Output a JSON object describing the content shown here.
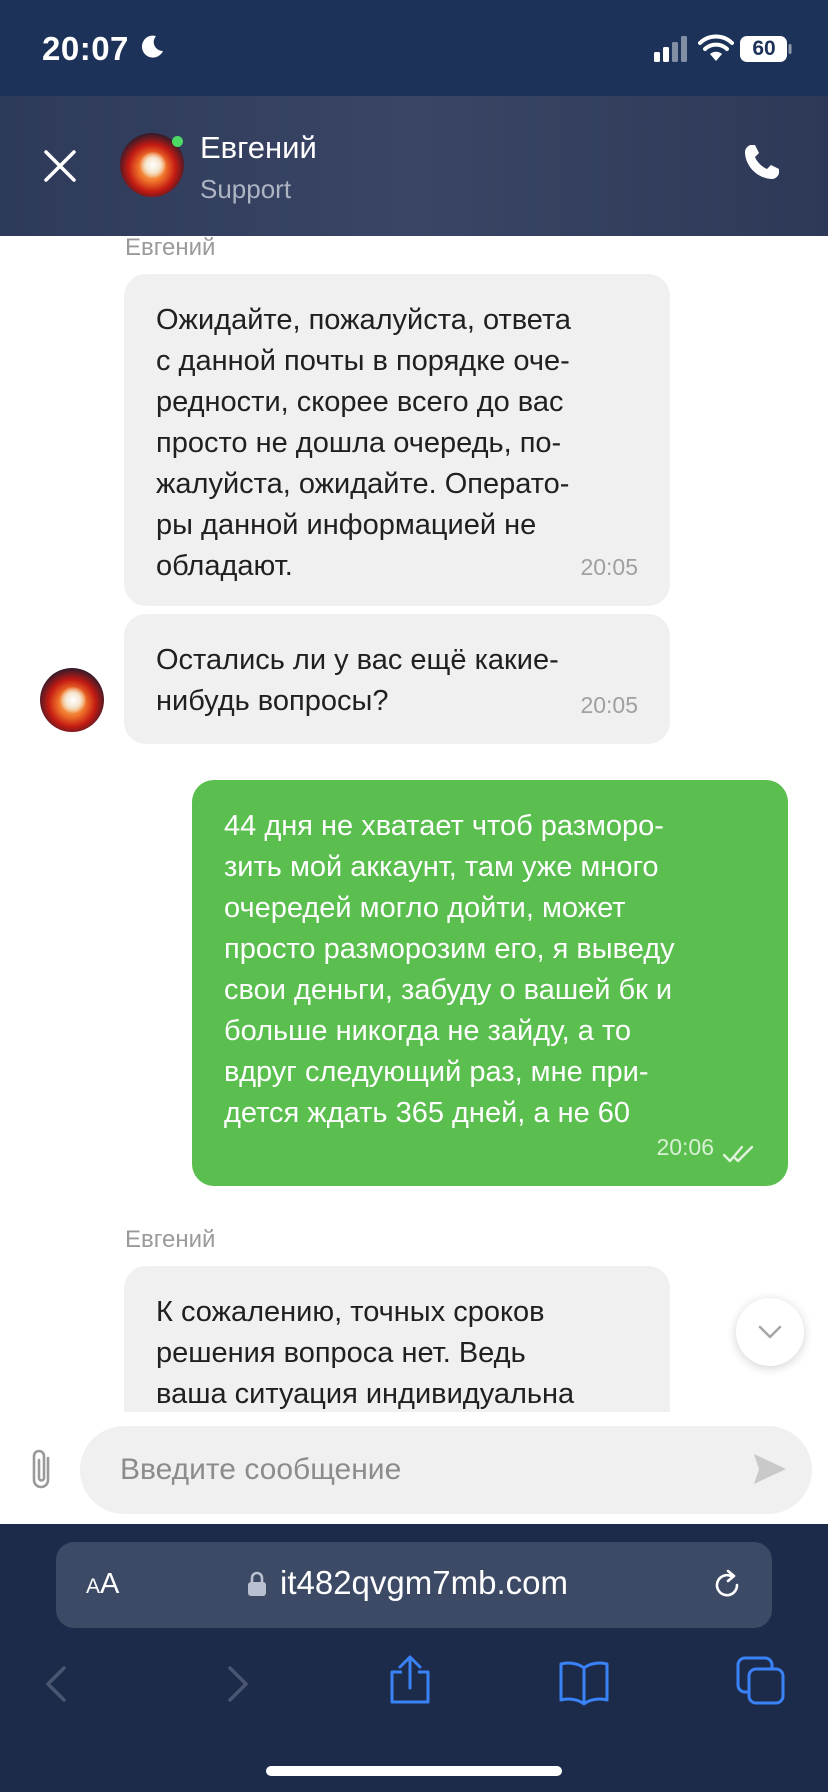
{
  "status_bar": {
    "time": "20:07",
    "battery": "60",
    "icons": [
      "moon-icon",
      "signal-icon",
      "wifi-icon",
      "battery-icon"
    ]
  },
  "header": {
    "contact_name": "Евгений",
    "contact_subtitle": "Support",
    "online": true,
    "icons": [
      "close-icon",
      "phone-icon"
    ]
  },
  "messages": [
    {
      "direction": "in",
      "sender": "Евгений",
      "text": "Ожидайте, пожалуйста, ответа\nс данной почты в порядке оче-\nредности, скорее всего до вас\nпросто не дошла очередь, по-\nжалуйста, ожидайте. Операто-\nры данной информацией не\nобладают.",
      "time": "20:05"
    },
    {
      "direction": "in",
      "text": "Остались ли у вас ещё какие-\nнибудь вопросы?",
      "time": "20:05"
    },
    {
      "direction": "out",
      "text": "44 дня не хватает чтоб разморо-\nзить мой аккаунт, там уже много\nочередей могло дойти, может\nпросто разморозим его, я выведу\nсвои деньги, забуду о вашей бк и\nбольше никогда не зайду, а то\nвдруг следующий раз, мне при-\nдется ждать 365 дней, а не 60",
      "time": "20:06",
      "status": "read"
    },
    {
      "direction": "in",
      "sender": "Евгений",
      "text": "К сожалению, точных сроков\nрешения вопроса нет. Ведь\nваша ситуация индивидуальна"
    }
  ],
  "composer": {
    "placeholder": "Введите сообщение",
    "icons": [
      "paperclip-icon",
      "send-icon"
    ]
  },
  "browser": {
    "text_size_small": "A",
    "text_size_big": "A",
    "url": "it482qvgm7mb.com",
    "icons": [
      "lock-icon",
      "reload-icon",
      "back-icon",
      "forward-icon",
      "share-icon",
      "bookmarks-icon",
      "tabs-icon"
    ]
  },
  "colors": {
    "status_bar_bg": "#1c3259",
    "header_bg": "#2e3a59",
    "incoming_bubble": "#f0f0f0",
    "outgoing_bubble": "#5bbf4f",
    "browser_bar": "#1c2b4a",
    "link_blue": "#3a82f7"
  }
}
